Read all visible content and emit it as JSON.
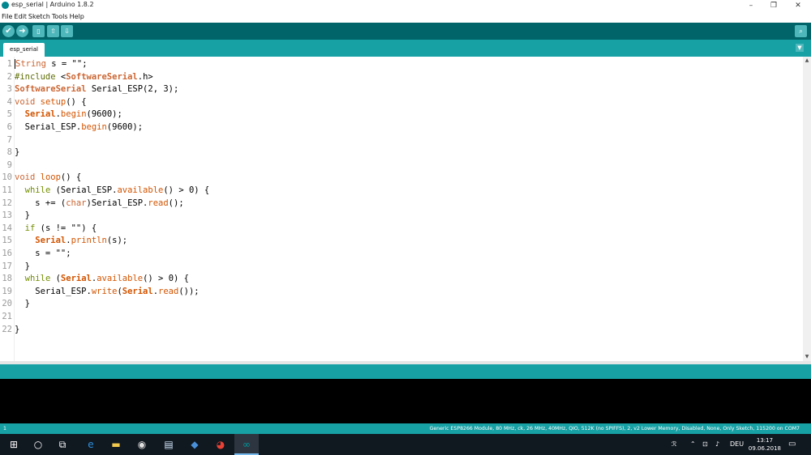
{
  "window": {
    "title": "esp_serial | Arduino 1.8.2",
    "minimize": "–",
    "restore": "❐",
    "close": "✕"
  },
  "menu": [
    "File",
    "Edit",
    "Sketch",
    "Tools",
    "Help"
  ],
  "toolbar": {
    "verify_icon": "check-icon",
    "verify_glyph": "✔",
    "upload_icon": "arrow-right-icon",
    "upload_glyph": "➜",
    "new_icon": "new-file-icon",
    "new_glyph": "▯",
    "open_icon": "arrow-up-icon",
    "open_glyph": "⇧",
    "save_icon": "arrow-down-icon",
    "save_glyph": "⇩",
    "serial_monitor_icon": "magnifier-icon",
    "serial_monitor_glyph": "⌕"
  },
  "tabs": [
    {
      "label": "esp_serial",
      "active": true
    }
  ],
  "tab_menu_glyph": "▼",
  "editor": {
    "line_numbers": [
      "1",
      "2",
      "3",
      "4",
      "5",
      "6",
      "7",
      "8",
      "9",
      "10",
      "11",
      "12",
      "13",
      "14",
      "15",
      "16",
      "17",
      "18",
      "19",
      "20",
      "21",
      "22"
    ],
    "lines": [
      "String s = \"\";",
      "#include <SoftwareSerial.h>",
      "SoftwareSerial Serial_ESP(2, 3);",
      "void setup() {",
      "  Serial.begin(9600);",
      "  Serial_ESP.begin(9600);",
      "",
      "}",
      "",
      "void loop() {",
      "  while (Serial_ESP.available() > 0) {",
      "    s += (char)Serial_ESP.read();",
      "  }",
      "  if (s != \"\") {",
      "    Serial.println(s);",
      "    s = \"\";",
      "  }",
      "  while (Serial.available() > 0) {",
      "    Serial_ESP.write(Serial.read());",
      "  }",
      "",
      "}"
    ]
  },
  "scroll": {
    "up": "▲",
    "down": "▼"
  },
  "bottom_status": {
    "line": "1",
    "board": "Generic ESP8266 Module, 80 MHz, ck, 26 MHz, 40MHz, QIO, 512K (no SPIFFS), 2, v2 Lower Memory, Disabled, None, Only Sketch, 115200 on COM7"
  },
  "taskbar": {
    "start_glyph": "⊞",
    "search_glyph": "○",
    "taskview_glyph": "⧉",
    "apps": [
      {
        "name": "edge-icon",
        "glyph": "e",
        "color": "#2f8fdc"
      },
      {
        "name": "file-explorer-icon",
        "glyph": "▬",
        "color": "#f2c94c"
      },
      {
        "name": "paint-icon",
        "glyph": "◉",
        "color": "#e0e0e0"
      },
      {
        "name": "notepad-icon",
        "glyph": "▤",
        "color": "#cfe3f7"
      },
      {
        "name": "thunderbird-icon",
        "glyph": "◆",
        "color": "#4a90d9"
      },
      {
        "name": "chrome-icon",
        "glyph": "◕",
        "color": "#e94235"
      },
      {
        "name": "arduino-icon",
        "glyph": "∞",
        "color": "#00979c"
      }
    ],
    "tray": {
      "people_glyph": "ℛ",
      "chevron_glyph": "⌃",
      "network_glyph": "⊡",
      "volume_glyph": "♪",
      "language": "DEU"
    },
    "time": "13:17",
    "date": "09.06.2018",
    "notification_glyph": "▭"
  }
}
